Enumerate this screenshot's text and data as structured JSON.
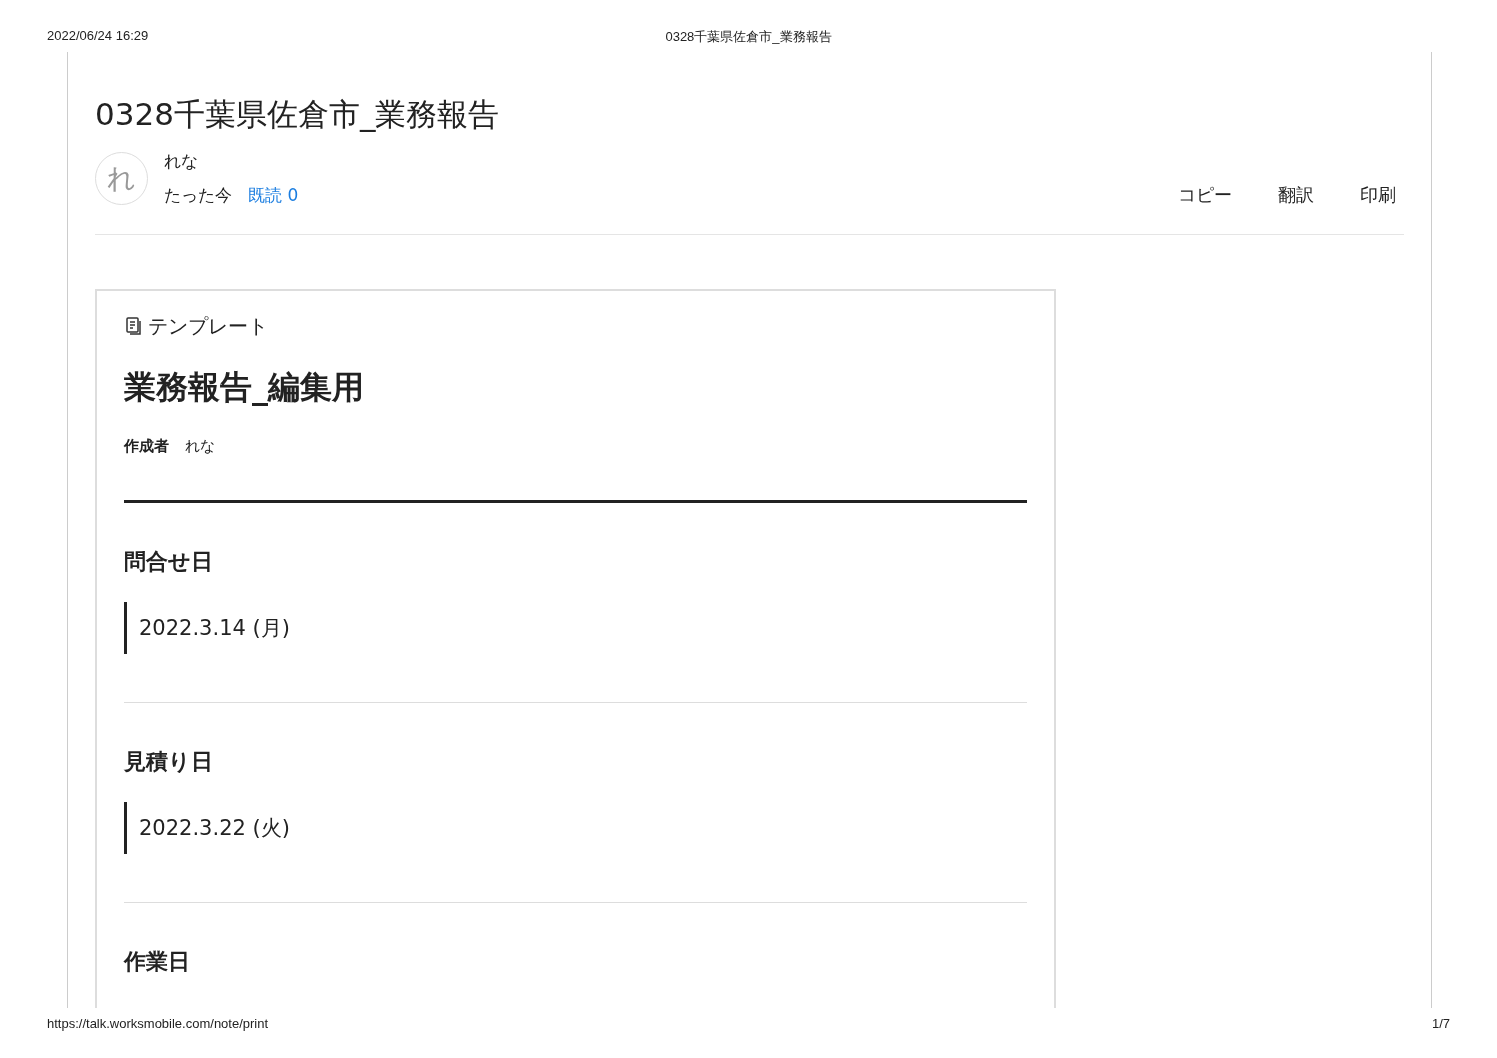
{
  "print_header": {
    "date": "2022/06/24 16:29",
    "title": "0328千葉県佐倉市_業務報告"
  },
  "note": {
    "title": "0328千葉県佐倉市_業務報告",
    "author": {
      "avatar": "れ",
      "name": "れな",
      "time": "たった今",
      "read": "既読 0"
    },
    "actions": [
      "コピー",
      "翻訳",
      "印刷"
    ],
    "template": {
      "label": "テンプレート",
      "title": "業務報告_編集用",
      "creator_label": "作成者",
      "creator": "れな",
      "fields": [
        {
          "label": "問合せ日",
          "value": "2022.3.14 (月)"
        },
        {
          "label": "見積り日",
          "value": "2022.3.22 (火)"
        },
        {
          "label": "作業日"
        }
      ]
    }
  },
  "print_footer": {
    "url": "https://talk.worksmobile.com/note/print",
    "page": "1/7"
  }
}
